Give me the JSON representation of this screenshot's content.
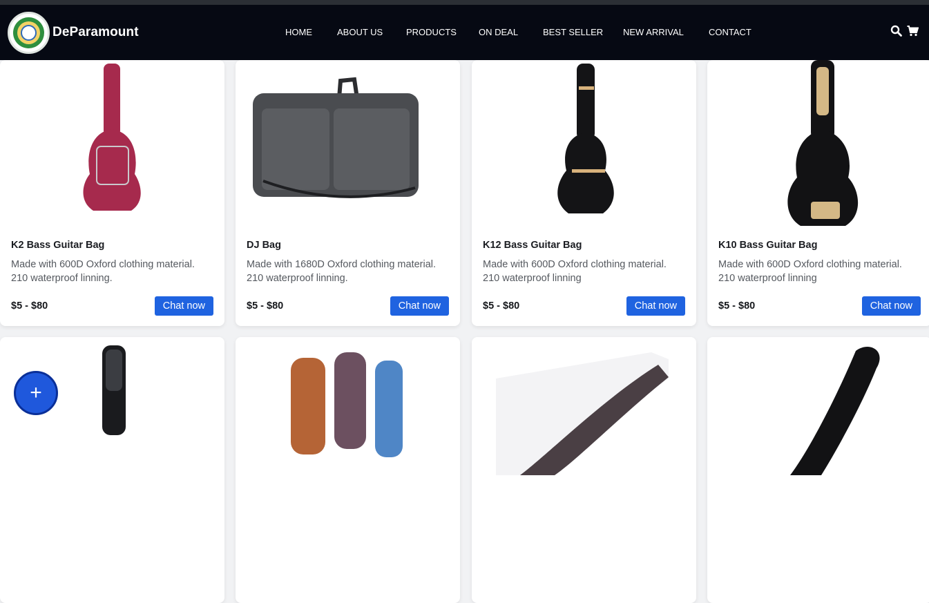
{
  "brand": {
    "name": "DeParamount"
  },
  "nav": {
    "links": [
      "HOME",
      "ABOUT US",
      "PRODUCTS",
      "ON DEAL",
      "BEST SELLER",
      "NEW ARRIVAL",
      "CONTACT"
    ],
    "icons": [
      "search-icon",
      "cart-icon"
    ]
  },
  "products": [
    {
      "title": "K2 Bass Guitar Bag",
      "desc": "Made with 600D Oxford clothing material. 210 waterproof linning.",
      "price": "$5 - $80",
      "cta": "Chat now",
      "color": "#a62a4d"
    },
    {
      "title": "DJ Bag",
      "desc": "Made with 1680D Oxford clothing material. 210 waterproof linning.",
      "price": "$5 - $80",
      "cta": "Chat now",
      "color": "#4a4c50"
    },
    {
      "title": "K12 Bass Guitar Bag",
      "desc": "Made with 600D Oxford clothing material. 210 waterproof linning",
      "price": "$5 - $80",
      "cta": "Chat now",
      "color": "#141416"
    },
    {
      "title": "K10 Bass Guitar Bag",
      "desc": "Made with 600D Oxford clothing material. 210 waterproof linning",
      "price": "$5 - $80",
      "cta": "Chat now",
      "color": "#121214"
    }
  ],
  "second_row_colors": [
    "#1a1b1e",
    "#b56436",
    "#6c5060",
    "#121214"
  ],
  "fab": {
    "label": "+"
  },
  "colors": {
    "navbar": "#060913",
    "button": "#1f63e0",
    "fab": "#1f58dc"
  }
}
